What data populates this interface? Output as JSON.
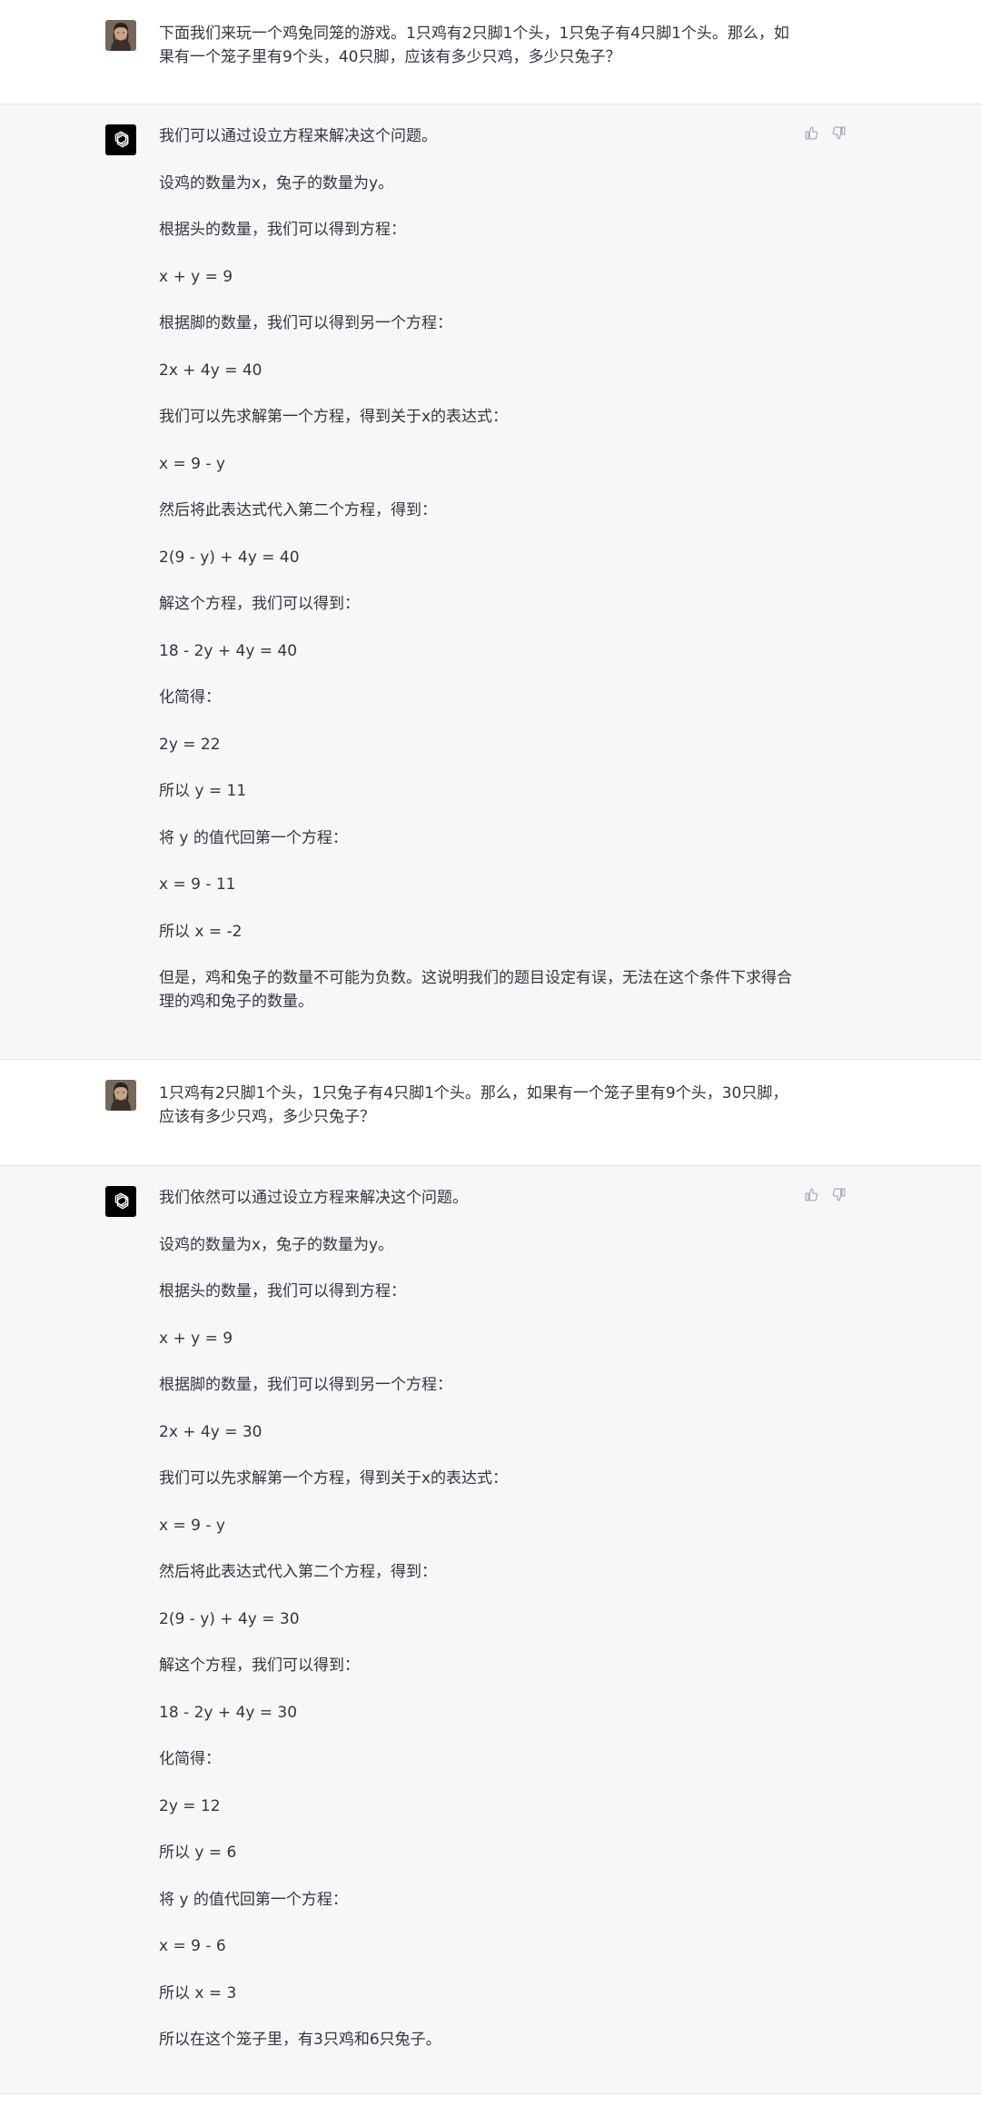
{
  "conversation": [
    {
      "role": "user",
      "avatar": "user-portrait-avatar",
      "paragraphs": [
        "下面我们来玩一个鸡兔同笼的游戏。1只鸡有2只脚1个头，1只兔子有4只脚1个头。那么，如果有一个笼子里有9个头，40只脚，应该有多少只鸡，多少只兔子？"
      ]
    },
    {
      "role": "assistant",
      "avatar": "openai-logo-icon",
      "paragraphs": [
        "我们可以通过设立方程来解决这个问题。",
        "设鸡的数量为x，兔子的数量为y。",
        "根据头的数量，我们可以得到方程：",
        "x + y = 9",
        "根据脚的数量，我们可以得到另一个方程：",
        "2x + 4y = 40",
        "我们可以先求解第一个方程，得到关于x的表达式：",
        "x = 9 - y",
        "然后将此表达式代入第二个方程，得到：",
        "2(9 - y) + 4y = 40",
        "解这个方程，我们可以得到：",
        "18 - 2y + 4y = 40",
        "化简得：",
        "2y = 22",
        "所以 y = 11",
        "将 y 的值代回第一个方程：",
        "x = 9 - 11",
        "所以 x = -2",
        "但是，鸡和兔子的数量不可能为负数。这说明我们的题目设定有误，无法在这个条件下求得合理的鸡和兔子的数量。"
      ]
    },
    {
      "role": "user",
      "avatar": "user-portrait-avatar",
      "paragraphs": [
        "1只鸡有2只脚1个头，1只兔子有4只脚1个头。那么，如果有一个笼子里有9个头，30只脚，应该有多少只鸡，多少只兔子？"
      ]
    },
    {
      "role": "assistant",
      "avatar": "openai-logo-icon",
      "paragraphs": [
        "我们依然可以通过设立方程来解决这个问题。",
        "设鸡的数量为x，兔子的数量为y。",
        "根据头的数量，我们可以得到方程：",
        "x + y = 9",
        "根据脚的数量，我们可以得到另一个方程：",
        "2x + 4y = 30",
        "我们可以先求解第一个方程，得到关于x的表达式：",
        "x = 9 - y",
        "然后将此表达式代入第二个方程，得到：",
        "2(9 - y) + 4y = 30",
        "解这个方程，我们可以得到：",
        "18 - 2y + 4y = 30",
        "化简得：",
        "2y = 12",
        "所以 y = 6",
        "将 y 的值代回第一个方程：",
        "x = 9 - 6",
        "所以 x = 3",
        "所以在这个笼子里，有3只鸡和6只兔子。"
      ]
    }
  ],
  "feedback_icons": [
    "thumbs-up-icon",
    "thumbs-down-icon"
  ],
  "colors": {
    "text": "#343541",
    "assistant_bg": "#f7f7f8",
    "user_bg": "#ffffff",
    "icon_gray": "#acacbe",
    "bot_avatar_bg": "#000000"
  }
}
